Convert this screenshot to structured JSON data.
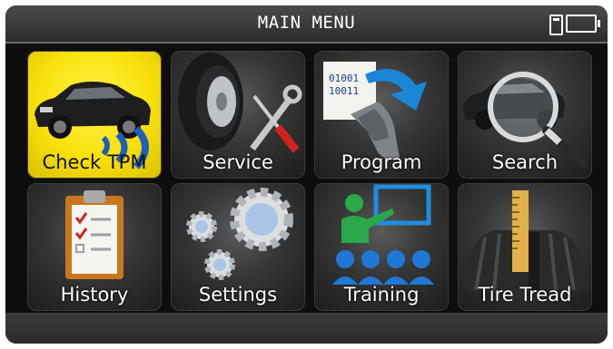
{
  "header": {
    "title": "MAIN MENU",
    "status_icons": [
      "sd-card-icon",
      "battery-icon"
    ]
  },
  "menu": [
    {
      "label": "Check TPM",
      "icon": "car-sensor-signal-icon",
      "selected": true
    },
    {
      "label": "Service",
      "icon": "tire-wrench-screwdriver-icon",
      "selected": false
    },
    {
      "label": "Program",
      "icon": "sensor-binary-program-icon",
      "selected": false
    },
    {
      "label": "Search",
      "icon": "car-magnifier-icon",
      "selected": false
    },
    {
      "label": "History",
      "icon": "clipboard-checklist-icon",
      "selected": false
    },
    {
      "label": "Settings",
      "icon": "gears-icon",
      "selected": false
    },
    {
      "label": "Training",
      "icon": "classroom-icon",
      "selected": false
    },
    {
      "label": "Tire Tread",
      "icon": "tire-tread-ruler-icon",
      "selected": false
    }
  ],
  "colors": {
    "selected_tile": "#f8e10c",
    "tile": "#353535",
    "background": "#141414"
  }
}
